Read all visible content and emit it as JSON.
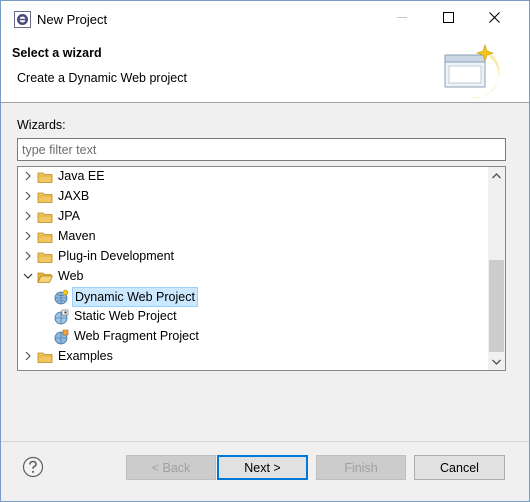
{
  "window": {
    "title": "New Project"
  },
  "banner": {
    "title": "Select a wizard",
    "description": "Create a Dynamic Web project"
  },
  "wizards": {
    "label": "Wizards:",
    "filter_placeholder": "type filter text",
    "filter_value": ""
  },
  "tree": {
    "items": [
      {
        "label": "Java EE",
        "kind": "folder",
        "expanded": false
      },
      {
        "label": "JAXB",
        "kind": "folder",
        "expanded": false
      },
      {
        "label": "JPA",
        "kind": "folder",
        "expanded": false
      },
      {
        "label": "Maven",
        "kind": "folder",
        "expanded": false
      },
      {
        "label": "Plug-in Development",
        "kind": "folder",
        "expanded": false
      },
      {
        "label": "Web",
        "kind": "folder",
        "expanded": true
      },
      {
        "label": "Dynamic Web Project",
        "kind": "wizard",
        "selected": true
      },
      {
        "label": "Static Web Project",
        "kind": "wizard"
      },
      {
        "label": "Web Fragment Project",
        "kind": "wizard"
      },
      {
        "label": "Examples",
        "kind": "folder",
        "expanded": false
      }
    ]
  },
  "buttons": {
    "back": "< Back",
    "next": "Next >",
    "finish": "Finish",
    "cancel": "Cancel"
  },
  "colors": {
    "selection_bg": "#cce8ff",
    "folder": "#e8b84a",
    "default_button_border": "#0078d7"
  }
}
